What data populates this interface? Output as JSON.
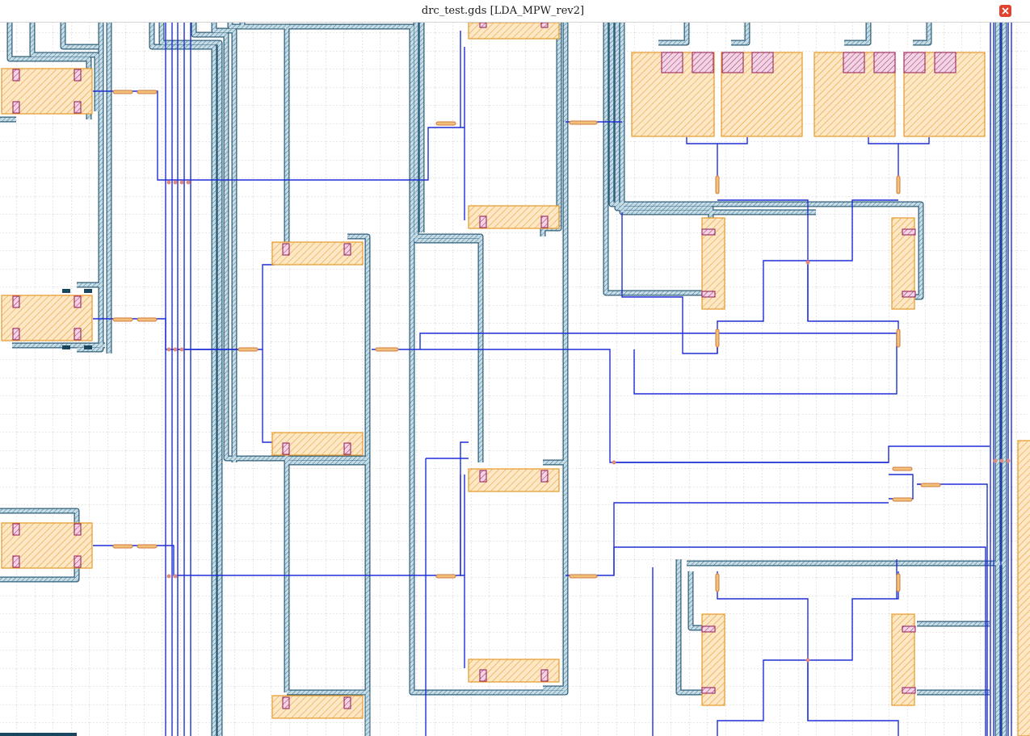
{
  "window": {
    "title": "drc_test.gds [LDA_MPW_rev2]",
    "close_icon": "close-icon"
  },
  "colors": {
    "background": "#ffffff",
    "grid": "#a8a8a8",
    "metal_wire": "#1f2fd6",
    "bus_fill": "#b9d3df",
    "bus_outline": "#2f5f78",
    "cell_fill": "#fde7c4",
    "cell_outline": "#e69a2a",
    "pad": "#9a2a62",
    "via": "#e18b7f",
    "close_button": "#e0442f"
  },
  "layout_view": {
    "icons": [
      "grid",
      "instance-cell",
      "contact-pad",
      "via",
      "metal-wire",
      "hatched-bus"
    ]
  }
}
